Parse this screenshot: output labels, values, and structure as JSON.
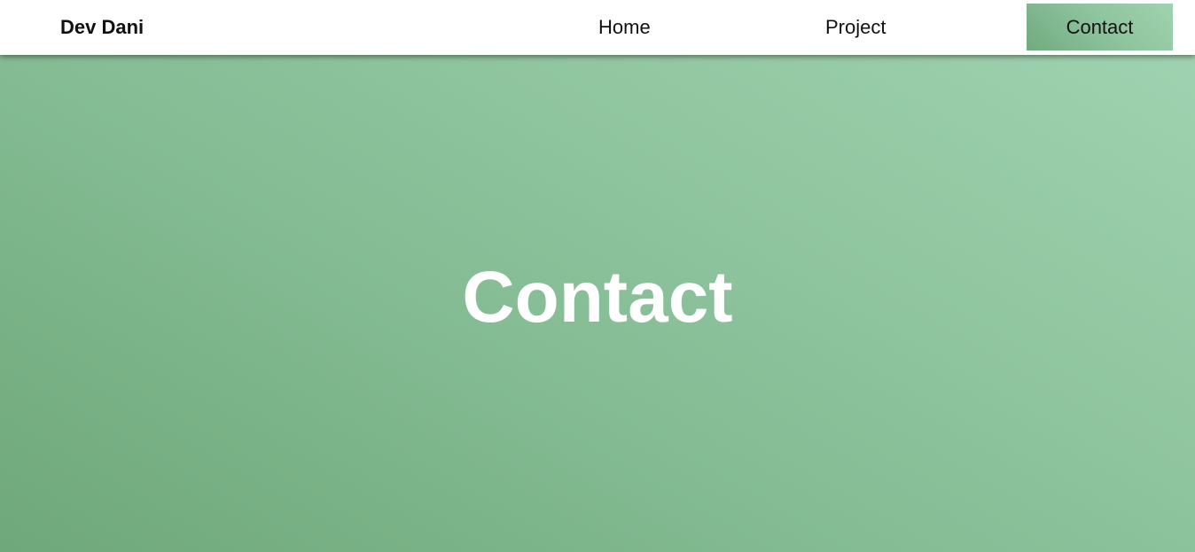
{
  "navbar": {
    "brand": "Dev Dani",
    "links": [
      {
        "label": "Home"
      },
      {
        "label": "Project"
      },
      {
        "label": "Contact",
        "active": true
      }
    ]
  },
  "hero": {
    "title": "Contact"
  },
  "colors": {
    "accent_light": "#a0d2b0",
    "accent_mid": "#86bd95",
    "accent_dark": "#6fa87a",
    "navbar_bg": "#ffffff",
    "hero_text": "#ffffff"
  }
}
